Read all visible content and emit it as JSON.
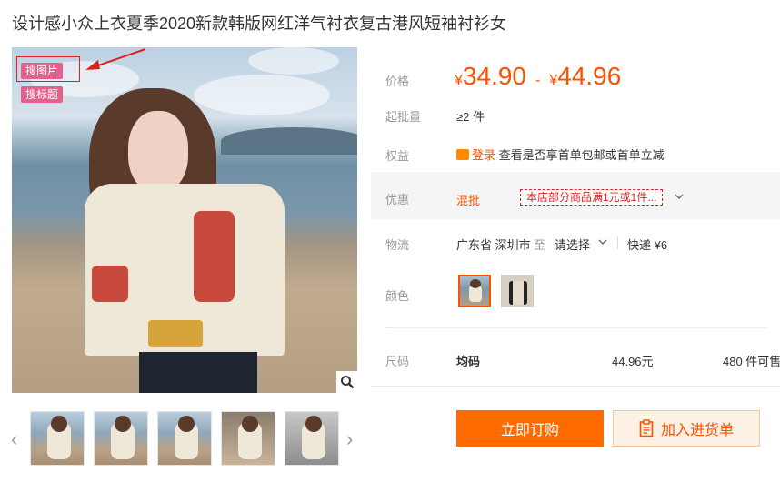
{
  "title": "设计感小众上衣夏季2020新款韩版网红洋气衬衣复古港风短袖衬衫女",
  "image_tags": {
    "search_image": "搜图片",
    "search_title": "搜标题"
  },
  "labels": {
    "price": "价格",
    "min_order": "起批量",
    "benefit": "权益",
    "promo": "优惠",
    "logistics": "物流",
    "color": "颜色",
    "size": "尺码"
  },
  "price": {
    "currency": "¥",
    "low": "34.90",
    "dash": "-",
    "high": "44.96"
  },
  "min_order": "≥2 件",
  "benefit": {
    "login": "登录",
    "text": "查看是否享首单包邮或首单立减"
  },
  "promo": {
    "type": "混批",
    "tag": "本店部分商品满1元或1件..."
  },
  "logistics": {
    "from": "广东省 深圳市",
    "to_word": "至",
    "select": "请选择",
    "express": "快递 ¥6"
  },
  "size_row": {
    "name": "均码",
    "price": "44.96元",
    "stock": "480 件可售"
  },
  "buttons": {
    "buy": "立即订购",
    "add": "加入进货单"
  },
  "colors": {
    "accent": "#ff5000",
    "buy_bg": "#ff6a00",
    "tag_pink": "#e95f8c",
    "highlight_red": "#e02020"
  },
  "icons": [
    "search-zoom-icon",
    "chevron-left-icon",
    "chevron-right-icon",
    "chevron-down-icon",
    "coupon-icon",
    "clipboard-icon",
    "arrow-annotation-icon"
  ]
}
